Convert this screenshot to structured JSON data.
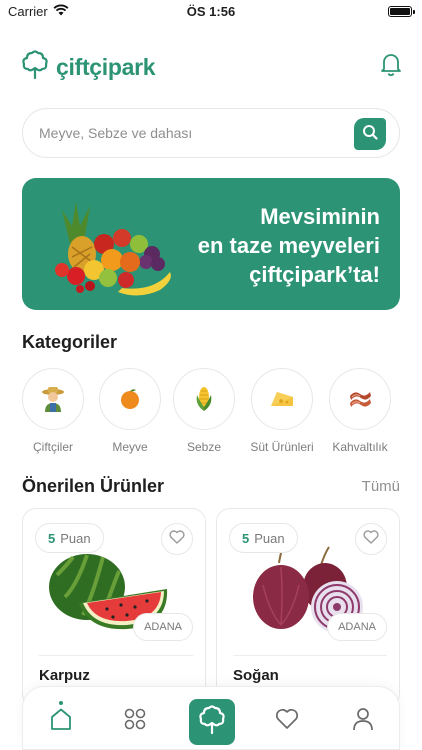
{
  "status_bar": {
    "carrier": "Carrier",
    "time": "ÖS 1:56"
  },
  "header": {
    "logo_text": "çiftçipark"
  },
  "search": {
    "placeholder": "Meyve, Sebze ve dahası"
  },
  "banner": {
    "line1": "Mevsiminin",
    "line2": "en taze meyveleri",
    "line3": "çiftçipark’ta!"
  },
  "categories": {
    "title": "Kategoriler",
    "items": [
      {
        "label": "Çiftçiler",
        "icon": "farmer-icon"
      },
      {
        "label": "Meyve",
        "icon": "orange-icon"
      },
      {
        "label": "Sebze",
        "icon": "corn-icon"
      },
      {
        "label": "Süt Ürünleri",
        "icon": "cheese-icon"
      },
      {
        "label": "Kahvaltılık",
        "icon": "bacon-icon"
      }
    ]
  },
  "recommended": {
    "title": "Önerilen Ürünler",
    "see_all": "Tümü",
    "products": [
      {
        "name": "Karpuz",
        "points": "5",
        "points_label": "Puan",
        "location": "ADANA",
        "icon": "watermelon-icon"
      },
      {
        "name": "Soğan",
        "points": "5",
        "points_label": "Puan",
        "location": "ADANA",
        "icon": "onion-icon"
      }
    ]
  },
  "tabbar": {
    "items": [
      "home-icon",
      "grid-icon",
      "logo-tree-icon",
      "heart-icon",
      "profile-icon"
    ],
    "active": "home"
  },
  "colors": {
    "accent": "#2c9474",
    "text": "#1f1f1f",
    "muted": "#8e8e8e",
    "border": "#e7e7e7"
  }
}
